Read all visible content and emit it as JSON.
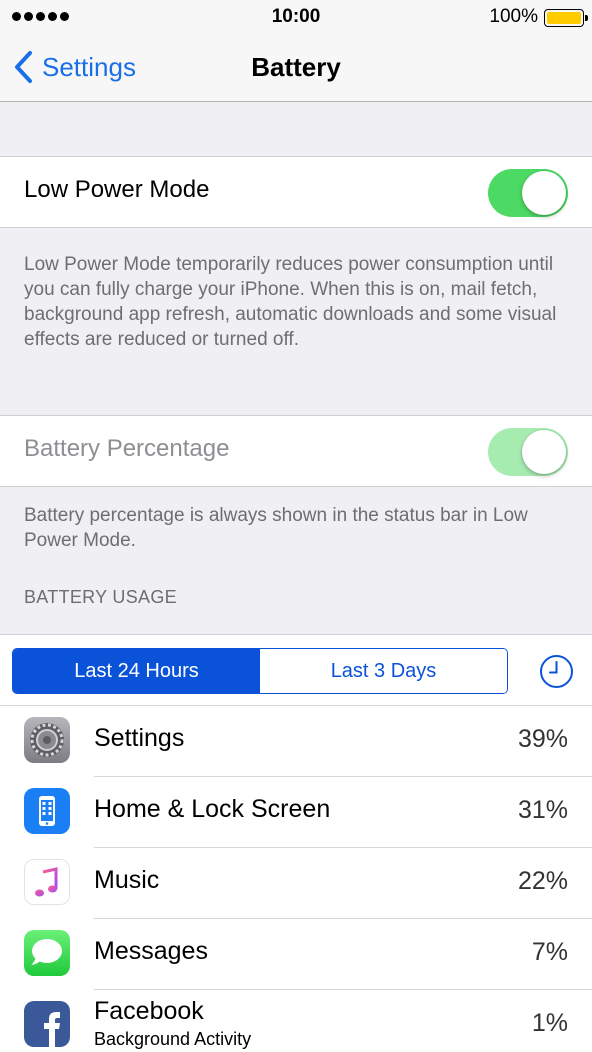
{
  "status_bar": {
    "time": "10:00",
    "battery_percent": "100%"
  },
  "nav": {
    "back_label": "Settings",
    "title": "Battery"
  },
  "low_power": {
    "label": "Low Power Mode",
    "on": true,
    "footer": "Low Power Mode temporarily reduces power consumption until you can fully charge your iPhone. When this is on, mail fetch, background app refresh, automatic downloads and some visual effects are reduced or turned off."
  },
  "battery_percentage": {
    "label": "Battery Percentage",
    "on": true,
    "disabled": true,
    "footer": "Battery percentage is always shown in the status bar in Low Power Mode."
  },
  "usage": {
    "header": "BATTERY USAGE",
    "segments": [
      "Last 24 Hours",
      "Last 3 Days"
    ],
    "selected_segment": "Last 24 Hours",
    "apps": [
      {
        "name": "Settings",
        "sub": "",
        "percent": "39%",
        "icon": "settings-gear-icon"
      },
      {
        "name": "Home & Lock Screen",
        "sub": "",
        "percent": "31%",
        "icon": "phone-screen-icon"
      },
      {
        "name": "Music",
        "sub": "",
        "percent": "22%",
        "icon": "music-note-icon"
      },
      {
        "name": "Messages",
        "sub": "",
        "percent": "7%",
        "icon": "message-bubble-icon"
      },
      {
        "name": "Facebook",
        "sub": "Background Activity",
        "percent": "1%",
        "icon": "facebook-icon"
      }
    ]
  },
  "colors": {
    "accent": "#0a53d9",
    "nav_tint": "#1a6ee8",
    "toggle_on": "#4cd964",
    "battery_fill": "#ffcc00"
  }
}
